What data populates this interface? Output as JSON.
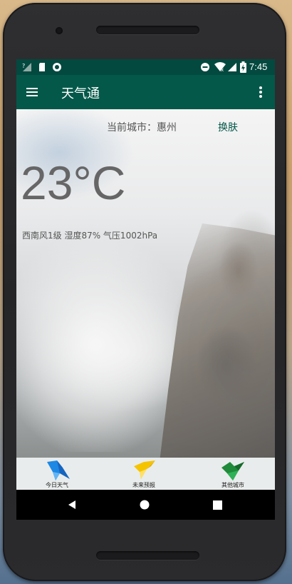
{
  "status_bar": {
    "time": "7:45",
    "icons": [
      "signal-unknown-icon",
      "sim-card-icon",
      "sync-icon",
      "do-not-disturb-icon",
      "wifi-icon",
      "mobile-signal-icon",
      "battery-charging-icon"
    ]
  },
  "app_bar": {
    "title": "天气通",
    "menu_icon": "hamburger-menu-icon",
    "overflow_icon": "more-vert-icon",
    "color": "#045849"
  },
  "weather": {
    "city_label": "当前城市：惠州",
    "skin_button": "换肤",
    "temperature": "23°C",
    "details": "西南风1级 湿度87% 气压1002hPa"
  },
  "bottom_nav": {
    "items": [
      {
        "label": "今日天气",
        "icon": "blue-bird-icon",
        "color": "#1e88e5"
      },
      {
        "label": "未来预报",
        "icon": "yellow-bird-icon",
        "color": "#f2c200"
      },
      {
        "label": "其他城市",
        "icon": "green-bird-icon",
        "color": "#1f8a3a"
      }
    ]
  },
  "system_nav": {
    "back": "back-icon",
    "home": "home-icon",
    "recents": "recents-icon"
  }
}
